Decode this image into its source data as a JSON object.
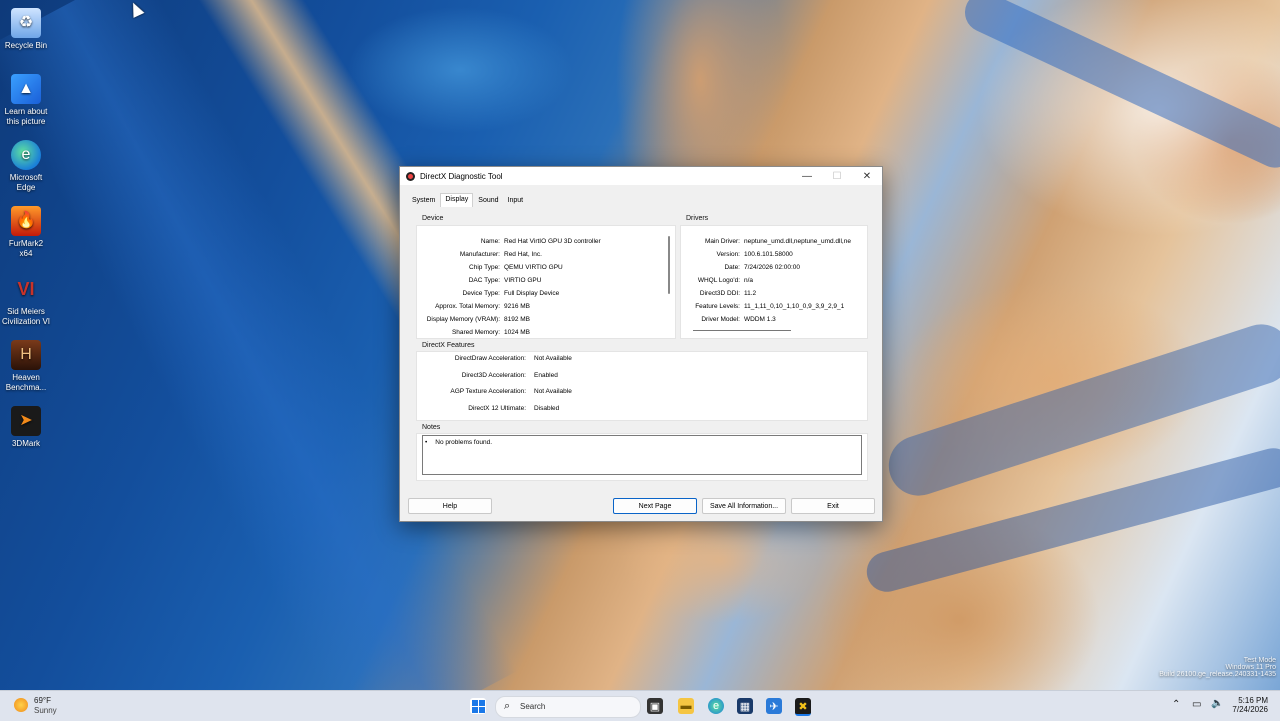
{
  "desktop": {
    "icons": [
      {
        "label": "Recycle Bin",
        "icon": "recycle-bin-icon"
      },
      {
        "label": "Learn about this picture",
        "icon": "picture-info-icon"
      },
      {
        "label": "Microsoft Edge",
        "icon": "edge-icon"
      },
      {
        "label": "FurMark2 x64",
        "icon": "furmark-icon"
      },
      {
        "label": "Sid Meiers Civilization VI",
        "icon": "civilization-icon"
      },
      {
        "label": "Heaven Benchma...",
        "icon": "heaven-icon"
      },
      {
        "label": "3DMark",
        "icon": "3dmark-icon"
      }
    ],
    "watermark": {
      "line1": "Test Mode",
      "line2": "Windows 11 Pro",
      "line3": "Build 26100.ge_release.240331-1435"
    }
  },
  "window": {
    "title": "DirectX Diagnostic Tool",
    "controls": {
      "minimize": "—",
      "maximize": "☐",
      "close": "✕"
    },
    "tabs": [
      "System",
      "Display",
      "Sound",
      "Input"
    ],
    "active_tab": "Display",
    "device": {
      "label": "Device",
      "rows": [
        {
          "key": "Name:",
          "value": "Red Hat VirtIO GPU 3D controller"
        },
        {
          "key": "Manufacturer:",
          "value": "Red Hat, Inc."
        },
        {
          "key": "Chip Type:",
          "value": "QEMU VIRTIO GPU"
        },
        {
          "key": "DAC Type:",
          "value": "VIRTIO GPU"
        },
        {
          "key": "Device Type:",
          "value": "Full Display Device"
        },
        {
          "key": "Approx. Total Memory:",
          "value": "9216 MB"
        },
        {
          "key": "Display Memory (VRAM):",
          "value": "8192 MB"
        },
        {
          "key": "Shared Memory:",
          "value": "1024 MB"
        }
      ]
    },
    "drivers": {
      "label": "Drivers",
      "rows": [
        {
          "key": "Main Driver:",
          "value": "neptune_umd.dll,neptune_umd.dll,ne"
        },
        {
          "key": "Version:",
          "value": "100.6.101.58000"
        },
        {
          "key": "Date:",
          "value": "7/24/2026 02:00:00"
        },
        {
          "key": "WHQL Logo'd:",
          "value": "n/a"
        },
        {
          "key": "Direct3D DDI:",
          "value": "11.2"
        },
        {
          "key": "Feature Levels:",
          "value": "11_1,11_0,10_1,10_0,9_3,9_2,9_1"
        },
        {
          "key": "Driver Model:",
          "value": "WDDM 1.3"
        }
      ]
    },
    "features": {
      "label": "DirectX Features",
      "rows": [
        {
          "key": "DirectDraw Acceleration:",
          "value": "Not Available"
        },
        {
          "key": "Direct3D Acceleration:",
          "value": "Enabled"
        },
        {
          "key": "AGP Texture Acceleration:",
          "value": "Not Available"
        },
        {
          "key": "DirectX 12 Ultimate:",
          "value": "Disabled"
        }
      ]
    },
    "notes": {
      "label": "Notes",
      "items": [
        "No problems found."
      ]
    },
    "buttons": {
      "help": "Help",
      "next_page": "Next Page",
      "save_all": "Save All Information...",
      "exit": "Exit"
    }
  },
  "taskbar": {
    "weather": {
      "temp": "69°F",
      "condition": "Sunny"
    },
    "search_placeholder": "Search",
    "clock": {
      "time": "5:16 PM",
      "date": "7/24/2026"
    }
  },
  "colors": {
    "accent": "#0a64c8",
    "taskbar_bg": "#dfe4ee"
  }
}
